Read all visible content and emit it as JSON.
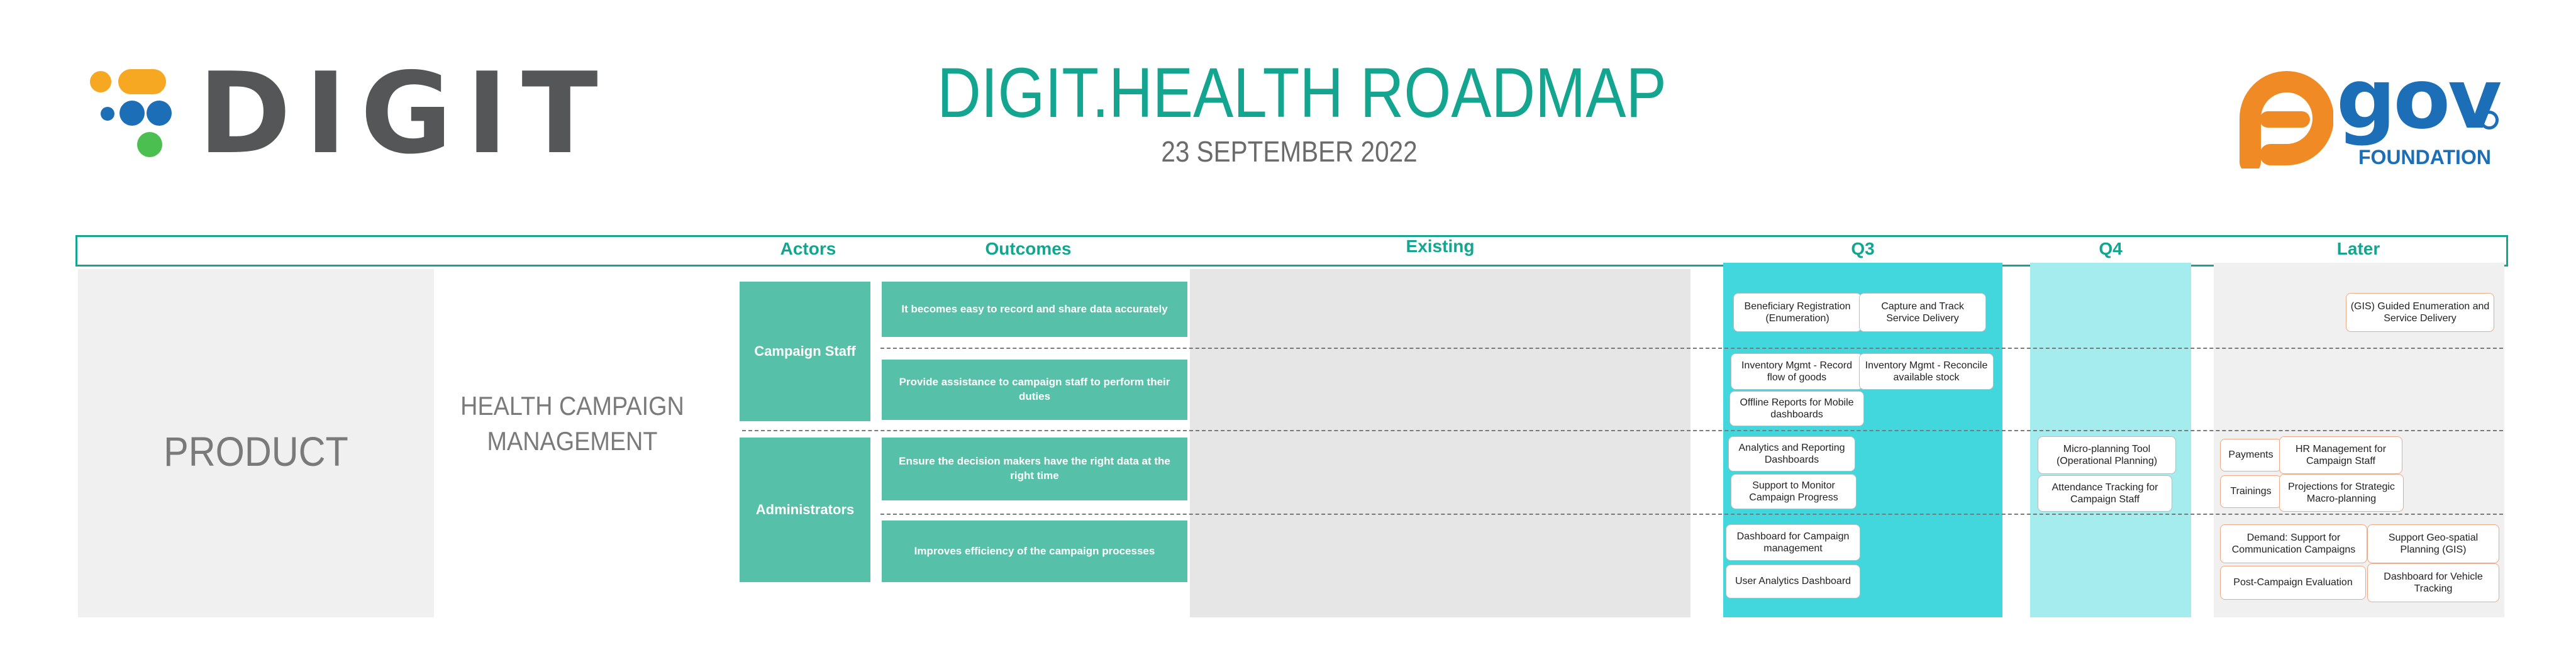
{
  "header": {
    "brand_left": "DIGIT",
    "title": "DIGIT.HEALTH ROADMAP",
    "date": "23 SEPTEMBER 2022",
    "brand_right": "gov",
    "brand_right_sub": "FOUNDATION"
  },
  "colors": {
    "teal": "#13a58f",
    "box_green": "#56c0a8",
    "q3_cyan": "#41d7dc",
    "q4_cyan": "#a4ecee",
    "existing_grey": "#e6e6e6",
    "panel_grey": "#f0f0f0",
    "later_border": "#efa986"
  },
  "columns": {
    "actors": "Actors",
    "outcomes": "Outcomes",
    "existing": "Existing",
    "q3": "Q3",
    "q4": "Q4",
    "later": "Later"
  },
  "product": "PRODUCT",
  "product_name": "HEALTH CAMPAIGN MANAGEMENT",
  "actors": [
    "Campaign Staff",
    "Administrators"
  ],
  "outcomes": [
    "It becomes easy to record and share data accurately",
    "Provide assistance to campaign staff to perform their duties",
    "Ensure the decision makers have the right data at the right time",
    "Improves efficiency of the campaign processes"
  ],
  "q3_items": [
    "Beneficiary Registration (Enumeration)",
    "Capture and Track Service Delivery",
    "Inventory Mgmt - Record flow of goods",
    "Inventory Mgmt - Reconcile available stock",
    "Offline Reports for Mobile dashboards",
    "Analytics and Reporting Dashboards",
    "Support to Monitor Campaign Progress",
    "Dashboard for Campaign management",
    "User Analytics Dashboard"
  ],
  "q4_items": [
    "Micro-planning Tool (Operational Planning)",
    "Attendance Tracking for Campaign Staff"
  ],
  "later_items": [
    "(GIS) Guided Enumeration and Service Delivery",
    "Payments",
    "HR Management for Campaign Staff",
    "Trainings",
    "Projections for Strategic Macro-planning",
    "Demand: Support for Communication Campaigns",
    "Support Geo-spatial Planning (GIS)",
    "Post-Campaign Evaluation",
    "Dashboard for Vehicle Tracking"
  ]
}
